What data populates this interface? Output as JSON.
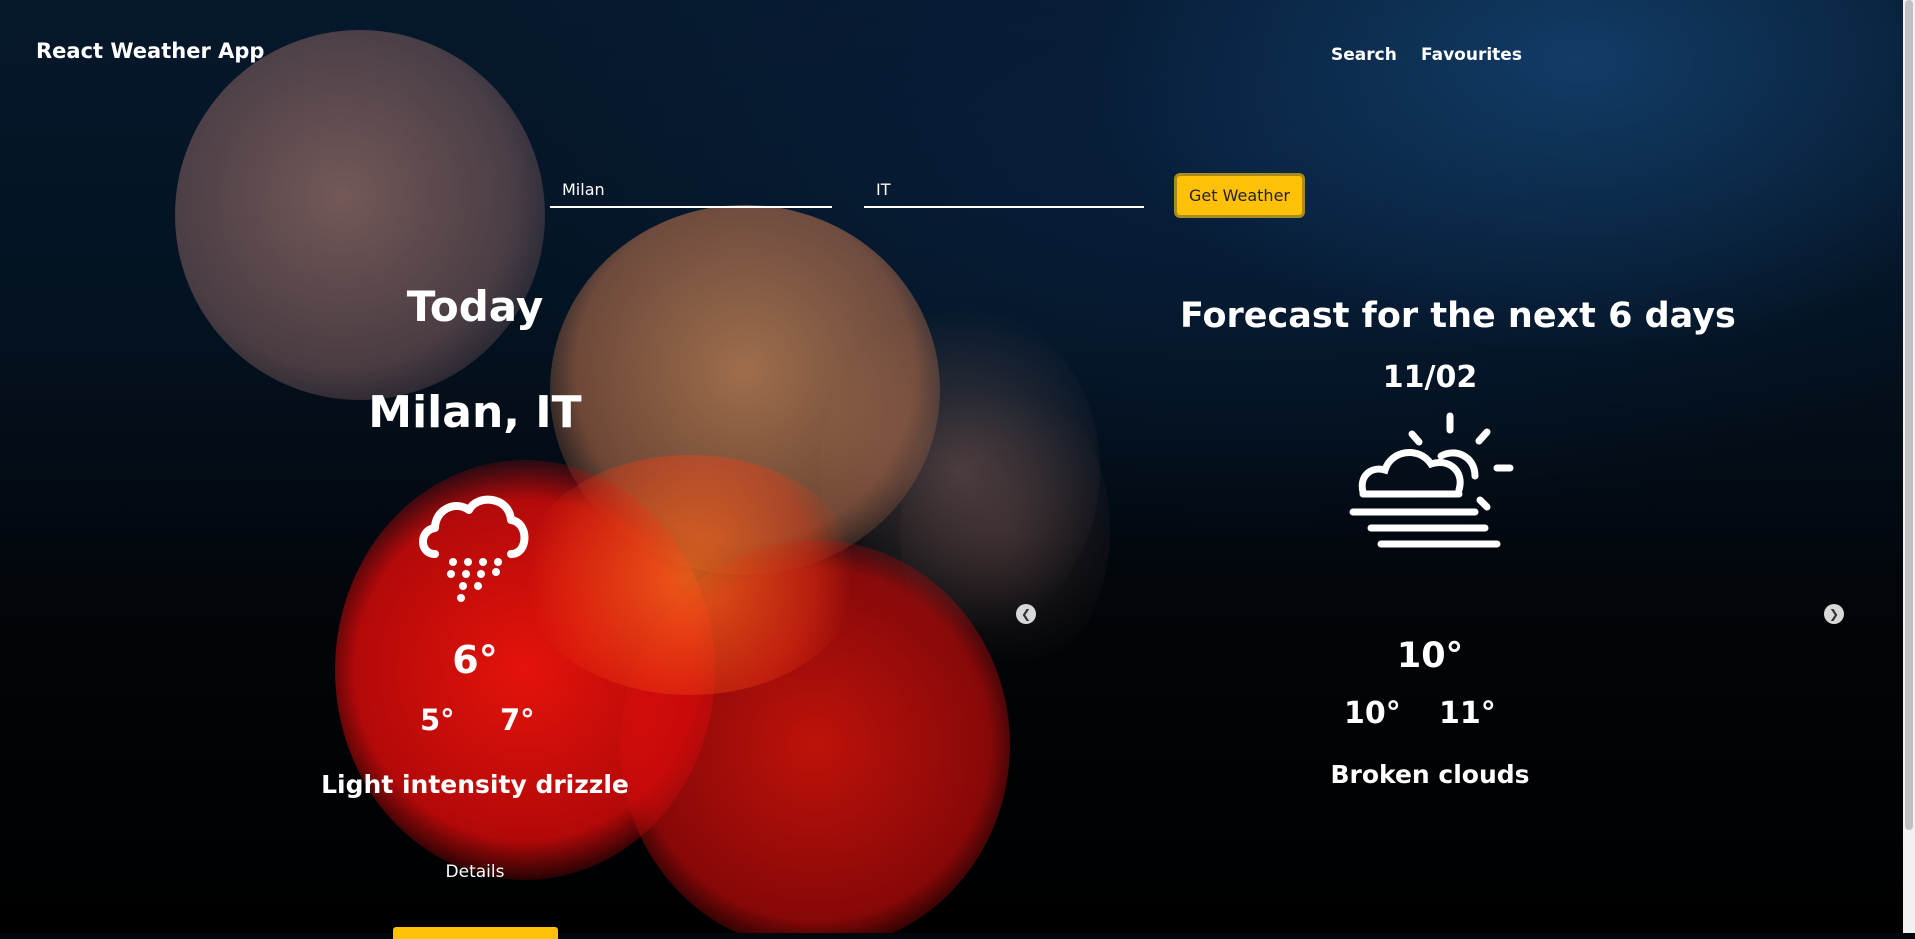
{
  "app": {
    "brand": "React Weather App",
    "nav": {
      "search": "Search",
      "favourites": "Favourites"
    }
  },
  "search_form": {
    "city_value": "Milan",
    "country_value": "IT",
    "button_label": "Get Weather",
    "button_color": "#ffc107"
  },
  "today": {
    "title": "Today",
    "location": "Milan, IT",
    "icon": "rain-drizzle-icon",
    "temp": "6°",
    "temp_min": "5°",
    "temp_max": "7°",
    "description": "Light intensity drizzle",
    "details_link": "Details"
  },
  "forecast": {
    "title": "Forecast for the next 6 days",
    "current_card": {
      "date": "11/02",
      "icon": "partly-cloudy-fog-icon",
      "temp": "10°",
      "temp_min": "10°",
      "temp_max": "11°",
      "description": "Broken clouds"
    },
    "prev_icon": "chevron-left-icon",
    "next_icon": "chevron-right-icon"
  }
}
